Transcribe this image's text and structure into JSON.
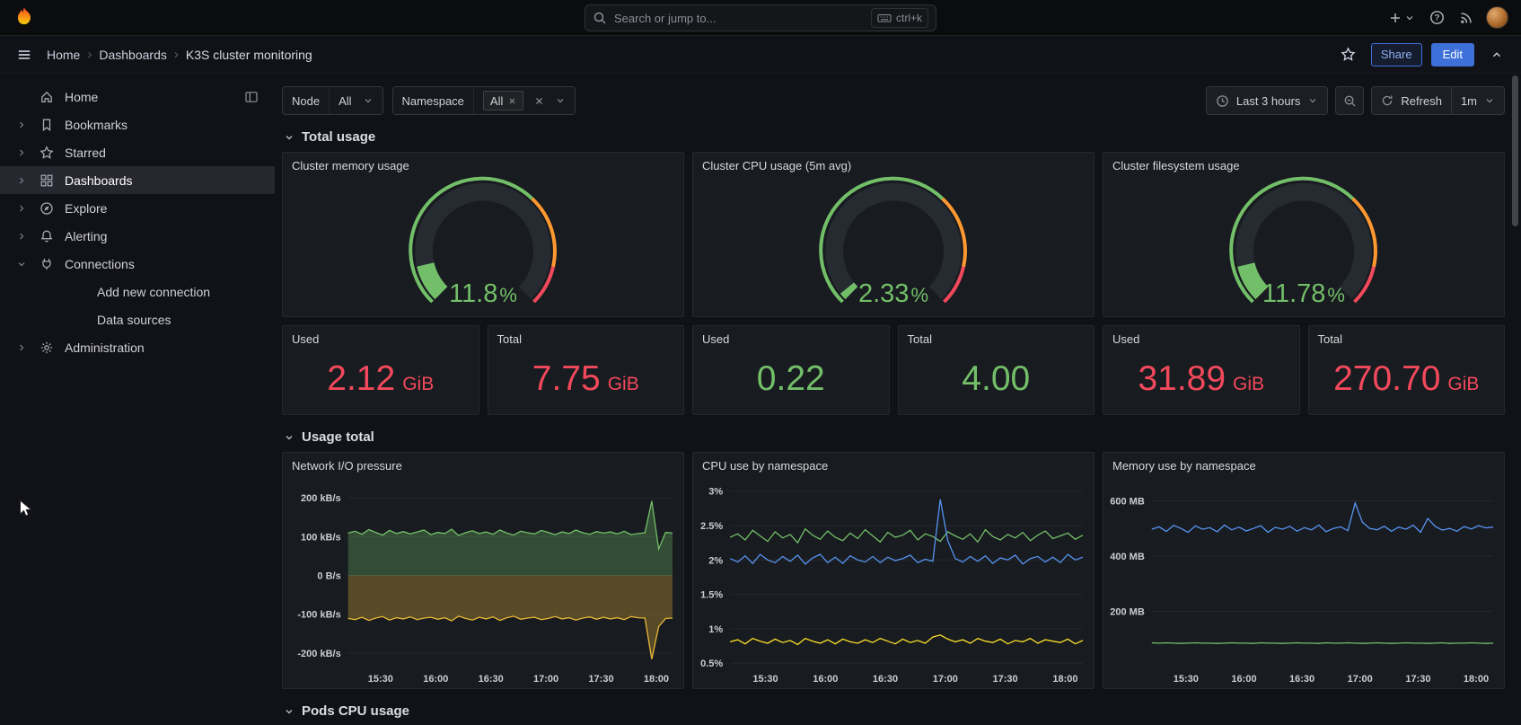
{
  "topbar": {
    "search_placeholder": "Search or jump to...",
    "search_shortcut": "ctrl+k"
  },
  "navbar": {
    "breadcrumbs": [
      "Home",
      "Dashboards",
      "K3S cluster monitoring"
    ],
    "share_label": "Share",
    "edit_label": "Edit"
  },
  "sidebar": {
    "items": [
      {
        "label": "Home"
      },
      {
        "label": "Bookmarks"
      },
      {
        "label": "Starred"
      },
      {
        "label": "Dashboards"
      },
      {
        "label": "Explore"
      },
      {
        "label": "Alerting"
      },
      {
        "label": "Connections"
      },
      {
        "label": "Add new connection"
      },
      {
        "label": "Data sources"
      },
      {
        "label": "Administration"
      }
    ]
  },
  "filters": {
    "node_label": "Node",
    "node_value": "All",
    "namespace_label": "Namespace",
    "namespace_tag": "All"
  },
  "time": {
    "range": "Last 3 hours",
    "refresh_label": "Refresh",
    "interval": "1m"
  },
  "sections": {
    "total_usage": "Total usage",
    "usage_total": "Usage total",
    "pods_cpu_usage": "Pods CPU usage"
  },
  "gauges": [
    {
      "title": "Cluster memory usage",
      "percent": 11.8,
      "display": "11.8",
      "unit": "%",
      "color": "#73bf69",
      "ring": [
        {
          "upto": 0.66,
          "color": "#73bf69"
        },
        {
          "upto": 0.88,
          "color": "#ff9830"
        },
        {
          "upto": 1,
          "color": "#f2495c"
        }
      ]
    },
    {
      "title": "Cluster CPU usage (5m avg)",
      "percent": 2.33,
      "display": "2.33",
      "unit": "%",
      "color": "#73bf69",
      "ring": [
        {
          "upto": 0.66,
          "color": "#73bf69"
        },
        {
          "upto": 0.88,
          "color": "#ff9830"
        },
        {
          "upto": 1,
          "color": "#f2495c"
        }
      ]
    },
    {
      "title": "Cluster filesystem usage",
      "percent": 11.78,
      "display": "11.78",
      "unit": "%",
      "color": "#73bf69",
      "ring": [
        {
          "upto": 0.66,
          "color": "#73bf69"
        },
        {
          "upto": 0.88,
          "color": "#ff9830"
        },
        {
          "upto": 1,
          "color": "#f2495c"
        }
      ]
    }
  ],
  "stats": [
    {
      "title": "Used",
      "value": "2.12",
      "unit": "GiB",
      "color": "#f2495c"
    },
    {
      "title": "Total",
      "value": "7.75",
      "unit": "GiB",
      "color": "#f2495c"
    },
    {
      "title": "Used",
      "value": "0.22",
      "unit": "",
      "color": "#73bf69"
    },
    {
      "title": "Total",
      "value": "4.00",
      "unit": "",
      "color": "#73bf69"
    },
    {
      "title": "Used",
      "value": "31.89",
      "unit": "GiB",
      "color": "#f2495c"
    },
    {
      "title": "Total",
      "value": "270.70",
      "unit": "GiB",
      "color": "#f2495c"
    }
  ],
  "chart_data": [
    {
      "type": "area",
      "title": "Network I/O pressure",
      "ylim": [
        -235,
        235
      ],
      "y_ticks": [
        {
          "v": 200,
          "label": "200 kB/s"
        },
        {
          "v": 100,
          "label": "100 kB/s"
        },
        {
          "v": 0,
          "label": "0 B/s"
        },
        {
          "v": -100,
          "label": "-100 kB/s"
        },
        {
          "v": -200,
          "label": "-200 kB/s"
        }
      ],
      "x_ticks": [
        {
          "f": 0.1,
          "label": "15:30"
        },
        {
          "f": 0.27,
          "label": "16:00"
        },
        {
          "f": 0.44,
          "label": "16:30"
        },
        {
          "f": 0.61,
          "label": "17:00"
        },
        {
          "f": 0.78,
          "label": "17:30"
        },
        {
          "f": 0.95,
          "label": "18:00"
        }
      ],
      "series": [
        {
          "color": "#73bf69",
          "fill": true,
          "values": [
            109,
            114,
            106,
            118,
            111,
            104,
            116,
            108,
            113,
            107,
            112,
            117,
            105,
            111,
            108,
            119,
            103,
            110,
            115,
            108,
            112,
            106,
            117,
            109,
            104,
            114,
            110,
            107,
            116,
            111,
            105,
            112,
            108,
            117,
            110,
            106,
            113,
            109,
            112,
            107,
            114,
            105,
            108,
            110,
            192,
            68,
            111,
            109
          ]
        },
        {
          "color": "#eab839",
          "fill": true,
          "values": [
            -111,
            -114,
            -108,
            -116,
            -110,
            -106,
            -115,
            -109,
            -112,
            -107,
            -114,
            -110,
            -108,
            -113,
            -109,
            -117,
            -105,
            -111,
            -115,
            -108,
            -112,
            -107,
            -116,
            -109,
            -105,
            -113,
            -110,
            -108,
            -114,
            -111,
            -106,
            -112,
            -109,
            -115,
            -110,
            -107,
            -113,
            -108,
            -112,
            -109,
            -114,
            -106,
            -109,
            -110,
            -216,
            -132,
            -111,
            -110
          ]
        }
      ]
    },
    {
      "type": "line",
      "title": "CPU use by namespace",
      "ylim": [
        0.45,
        3.1
      ],
      "y_ticks": [
        {
          "v": 3,
          "label": "3%"
        },
        {
          "v": 2.5,
          "label": "2.5%"
        },
        {
          "v": 2,
          "label": "2%"
        },
        {
          "v": 1.5,
          "label": "1.5%"
        },
        {
          "v": 1,
          "label": "1%"
        },
        {
          "v": 0.5,
          "label": "0.5%"
        }
      ],
      "x_ticks": [
        {
          "f": 0.1,
          "label": "15:30"
        },
        {
          "f": 0.27,
          "label": "16:00"
        },
        {
          "f": 0.44,
          "label": "16:30"
        },
        {
          "f": 0.61,
          "label": "17:00"
        },
        {
          "f": 0.78,
          "label": "17:30"
        },
        {
          "f": 0.95,
          "label": "18:00"
        }
      ],
      "series": [
        {
          "color": "#73bf69",
          "fill": false,
          "values": [
            2.33,
            2.38,
            2.29,
            2.43,
            2.35,
            2.27,
            2.41,
            2.32,
            2.37,
            2.25,
            2.45,
            2.36,
            2.3,
            2.42,
            2.33,
            2.28,
            2.39,
            2.31,
            2.44,
            2.35,
            2.26,
            2.4,
            2.33,
            2.36,
            2.43,
            2.29,
            2.38,
            2.34,
            2.27,
            2.41,
            2.35,
            2.3,
            2.38,
            2.26,
            2.44,
            2.34,
            2.29,
            2.37,
            2.32,
            2.4,
            2.28,
            2.36,
            2.42,
            2.31,
            2.35,
            2.39,
            2.3,
            2.36
          ]
        },
        {
          "color": "#5794f2",
          "fill": false,
          "values": [
            2.02,
            1.97,
            2.06,
            1.95,
            2.08,
            2.0,
            1.96,
            2.05,
            1.98,
            2.07,
            1.94,
            2.03,
            2.08,
            1.96,
            2.04,
            1.95,
            2.06,
            2.0,
            1.97,
            2.05,
            1.96,
            2.04,
            1.99,
            2.02,
            2.07,
            1.96,
            2.01,
            1.98,
            2.88,
            2.28,
            2.02,
            1.97,
            2.05,
            1.98,
            2.06,
            1.95,
            2.03,
            2.0,
            2.07,
            1.94,
            2.02,
            2.05,
            1.97,
            2.04,
            1.96,
            2.08,
            2.0,
            2.04
          ]
        },
        {
          "color": "#fade2a",
          "fill": false,
          "values": [
            0.81,
            0.84,
            0.78,
            0.86,
            0.82,
            0.79,
            0.85,
            0.8,
            0.83,
            0.77,
            0.86,
            0.82,
            0.79,
            0.84,
            0.78,
            0.85,
            0.81,
            0.79,
            0.84,
            0.8,
            0.86,
            0.82,
            0.78,
            0.85,
            0.8,
            0.83,
            0.79,
            0.88,
            0.91,
            0.85,
            0.81,
            0.84,
            0.79,
            0.86,
            0.82,
            0.8,
            0.85,
            0.78,
            0.83,
            0.81,
            0.86,
            0.79,
            0.84,
            0.82,
            0.8,
            0.85,
            0.78,
            0.83
          ]
        }
      ]
    },
    {
      "type": "line",
      "title": "Memory use by namespace",
      "ylim": [
        0,
        660
      ],
      "y_ticks": [
        {
          "v": 600,
          "label": "600 MB"
        },
        {
          "v": 400,
          "label": "400 MB"
        },
        {
          "v": 200,
          "label": "200 MB"
        }
      ],
      "x_ticks": [
        {
          "f": 0.1,
          "label": "15:30"
        },
        {
          "f": 0.27,
          "label": "16:00"
        },
        {
          "f": 0.44,
          "label": "16:30"
        },
        {
          "f": 0.61,
          "label": "17:00"
        },
        {
          "f": 0.78,
          "label": "17:30"
        },
        {
          "f": 0.95,
          "label": "18:00"
        }
      ],
      "series": [
        {
          "color": "#5794f2",
          "fill": false,
          "values": [
            497,
            506,
            489,
            511,
            500,
            486,
            509,
            497,
            503,
            488,
            512,
            495,
            505,
            491,
            500,
            510,
            486,
            504,
            497,
            508,
            490,
            503,
            495,
            512,
            488,
            500,
            506,
            492,
            592,
            522,
            500,
            495,
            508,
            490,
            505,
            497,
            512,
            486,
            536,
            508,
            494,
            500,
            490,
            507,
            498,
            510,
            502,
            505
          ]
        },
        {
          "color": "#73bf69",
          "fill": false,
          "values": [
            86,
            85,
            86,
            85,
            84,
            85,
            86,
            85,
            85,
            84,
            85,
            86,
            85,
            85,
            84,
            86,
            85,
            85,
            84,
            85,
            86,
            85,
            85,
            84,
            86,
            85,
            85,
            86,
            85,
            84,
            85,
            86,
            85,
            84,
            85,
            86,
            85,
            85,
            84,
            85,
            86,
            84,
            85,
            85,
            86,
            85,
            84,
            85
          ]
        }
      ]
    }
  ]
}
